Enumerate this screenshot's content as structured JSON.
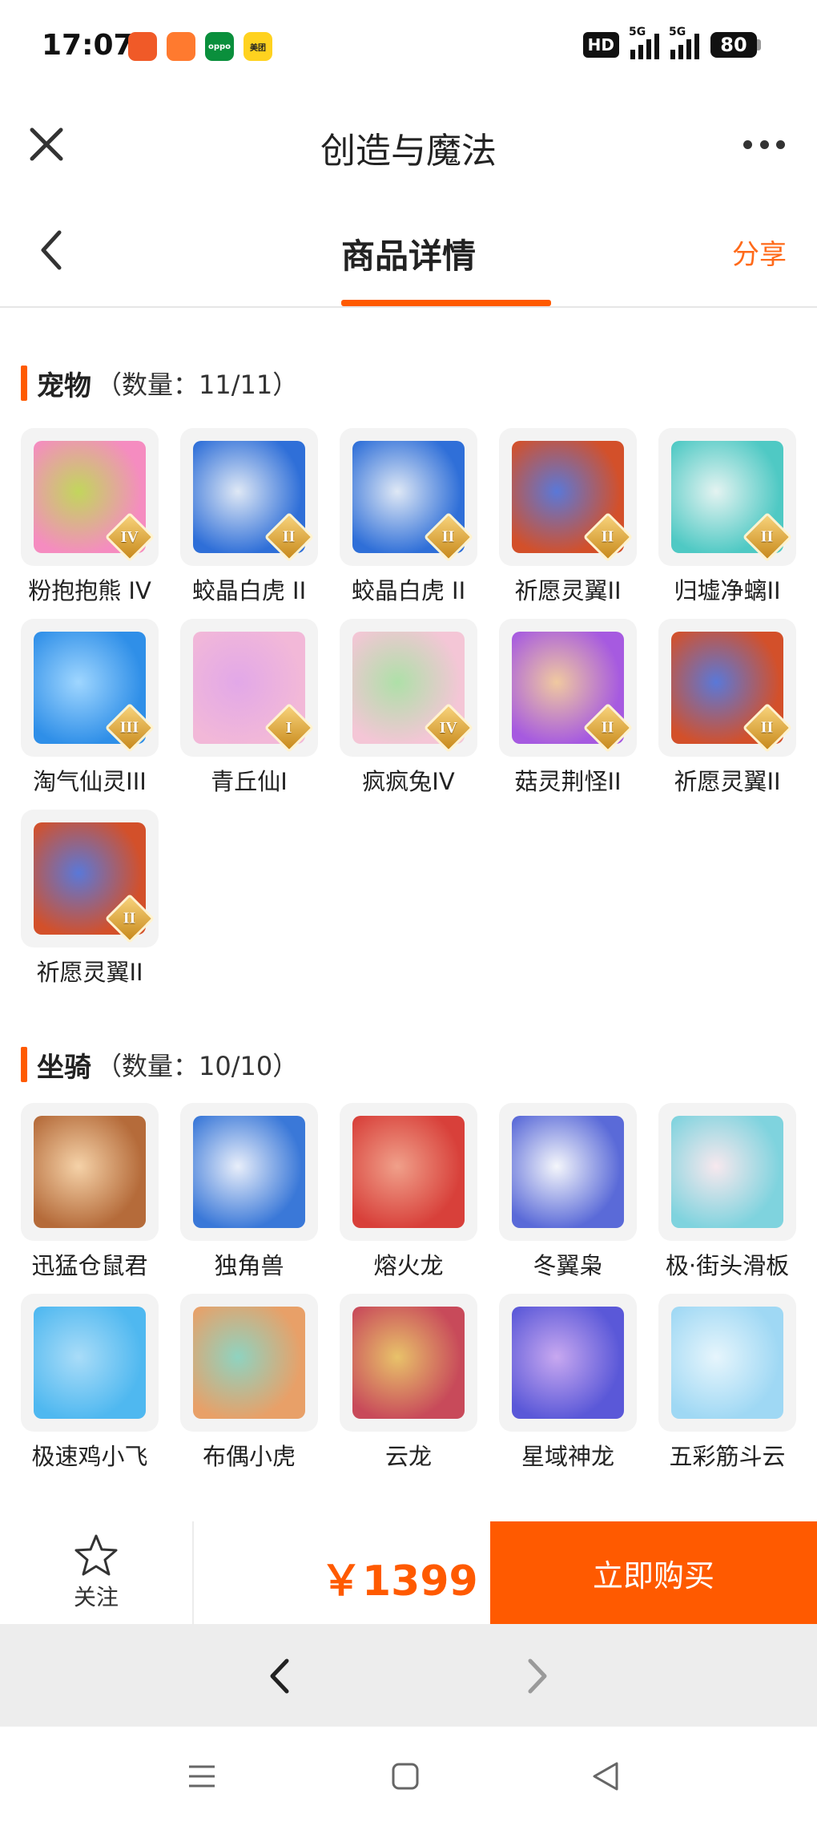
{
  "status_bar": {
    "time": "17:07",
    "apps": [
      {
        "name": "instagram-like-app",
        "color": "#f05a28",
        "label": ""
      },
      {
        "name": "orange-app",
        "color": "#ff7a2f",
        "label": ""
      },
      {
        "name": "oppo-app",
        "color": "#0a8f3c",
        "label": "oppo"
      },
      {
        "name": "meituan-app",
        "color": "#ffd21f",
        "label": "美团"
      }
    ],
    "hd_label": "HD",
    "network_1": "5G",
    "network_2": "5G",
    "battery": "80"
  },
  "app_bar": {
    "title": "创造与魔法"
  },
  "page_header": {
    "title": "商品详情",
    "share_label": "分享",
    "accent_color": "#ff5a00"
  },
  "sections": [
    {
      "name": "宠物",
      "count_text": "（数量：11/11）",
      "items": [
        {
          "name": "粉抱抱熊 IV",
          "badge": "IV",
          "colors": [
            "#f58cc0",
            "#c2d65c"
          ]
        },
        {
          "name": "蛟晶白虎 II",
          "badge": "II",
          "colors": [
            "#2f6fd8",
            "#dfe8f5"
          ]
        },
        {
          "name": "蛟晶白虎 II",
          "badge": "II",
          "colors": [
            "#2f6fd8",
            "#dfe8f5"
          ]
        },
        {
          "name": "祈愿灵翼II",
          "badge": "II",
          "colors": [
            "#d3502a",
            "#5a78d8"
          ]
        },
        {
          "name": "归墟净螭II",
          "badge": "II",
          "colors": [
            "#4fc9c4",
            "#e4f3f1"
          ]
        },
        {
          "name": "淘气仙灵III",
          "badge": "III",
          "colors": [
            "#2f8fe8",
            "#9fd6ff"
          ]
        },
        {
          "name": "青丘仙I",
          "badge": "I",
          "colors": [
            "#f2b8d8",
            "#e2a8e8"
          ]
        },
        {
          "name": "疯疯兔IV",
          "badge": "IV",
          "colors": [
            "#f4c6d6",
            "#aee0a8"
          ]
        },
        {
          "name": "菇灵荆怪II",
          "badge": "II",
          "colors": [
            "#a65ae0",
            "#f0c9a0"
          ]
        },
        {
          "name": "祈愿灵翼II",
          "badge": "II",
          "colors": [
            "#d3502a",
            "#5a78d8"
          ]
        },
        {
          "name": "祈愿灵翼II",
          "badge": "II",
          "colors": [
            "#d3502a",
            "#5a78d8"
          ]
        }
      ]
    },
    {
      "name": "坐骑",
      "count_text": "（数量：10/10）",
      "items": [
        {
          "name": "迅猛仓鼠君",
          "badge": "",
          "colors": [
            "#b56b3a",
            "#f5d2a8"
          ]
        },
        {
          "name": "独角兽",
          "badge": "",
          "colors": [
            "#3a78d8",
            "#e8eefa"
          ]
        },
        {
          "name": "熔火龙",
          "badge": "",
          "colors": [
            "#d8403a",
            "#f0a08a"
          ]
        },
        {
          "name": "冬翼枭",
          "badge": "",
          "colors": [
            "#5a6ad8",
            "#f4f6fb"
          ]
        },
        {
          "name": "极·街头滑板",
          "badge": "",
          "colors": [
            "#7fd3de",
            "#f7e8ee"
          ]
        },
        {
          "name": "极速鸡小飞",
          "badge": "",
          "colors": [
            "#4fb8f0",
            "#a9dcf8"
          ]
        },
        {
          "name": "布偶小虎",
          "badge": "",
          "colors": [
            "#e8a068",
            "#8fd3c0"
          ]
        },
        {
          "name": "云龙",
          "badge": "",
          "colors": [
            "#c84a5a",
            "#e8c26a"
          ]
        },
        {
          "name": "星域神龙",
          "badge": "",
          "colors": [
            "#5a58d8",
            "#c8a8f0"
          ]
        },
        {
          "name": "五彩筋斗云",
          "badge": "",
          "colors": [
            "#9fd8f4",
            "#e6f5fc"
          ]
        }
      ]
    }
  ],
  "bottom_bar": {
    "follow_label": "关注",
    "price": "￥1399",
    "buy_label": "立即购买"
  }
}
